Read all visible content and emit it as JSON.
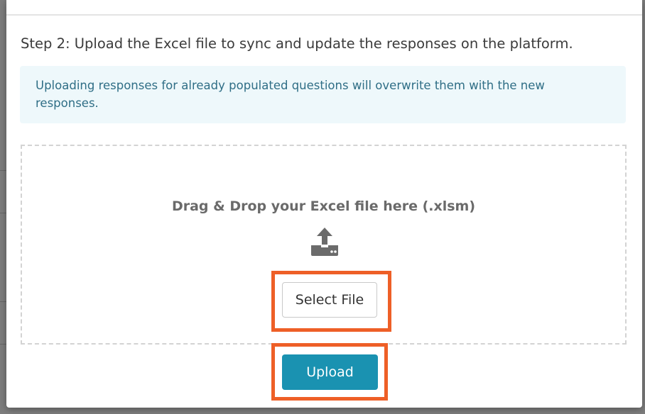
{
  "modal": {
    "step_text": "Step 2: Upload the Excel file to sync and update the responses on the platform.",
    "info_text": "Uploading responses for already populated questions will overwrite them with the new responses.",
    "dropzone": {
      "label": "Drag & Drop your Excel file here (.xlsm)",
      "icon": "upload-icon"
    },
    "select_file_label": "Select File",
    "upload_label": "Upload"
  },
  "colors": {
    "highlight": "#ee5f27",
    "primary_button": "#1a92b1",
    "info_background": "#eef8fb",
    "info_text": "#2f6e86"
  }
}
